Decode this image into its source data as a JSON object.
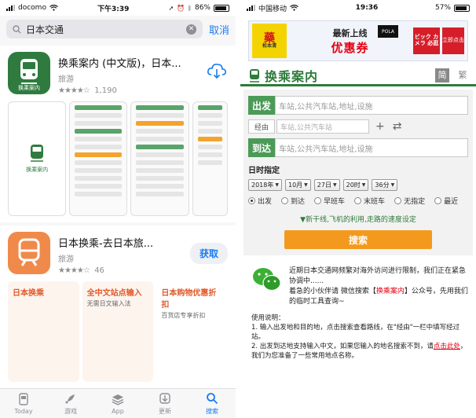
{
  "left": {
    "status": {
      "carrier": "docomo",
      "time": "下午3:39",
      "battery": "86%"
    },
    "search": {
      "query": "日本交通",
      "cancel": "取消"
    },
    "app1": {
      "title": "换乘案内 (中文版)，日本...",
      "category": "旅游",
      "rating_count": "1,190",
      "icon_label": "换乘案内"
    },
    "app2": {
      "title": "日本换乘-去日本旅...",
      "category": "旅游",
      "rating_count": "46",
      "get": "获取",
      "shot1": "日本换乘",
      "shot2_title": "全中文站点输入",
      "shot2_sub": "无需日文输入法",
      "shot3_title": "日本购物优惠折扣",
      "shot3_sub": "百货店专享折扣"
    },
    "tabs": [
      {
        "label": "Today",
        "icon": "today-icon"
      },
      {
        "label": "游戏",
        "icon": "rocket-icon"
      },
      {
        "label": "App",
        "icon": "layers-icon"
      },
      {
        "label": "更新",
        "icon": "download-icon"
      },
      {
        "label": "搜索",
        "icon": "search-icon"
      }
    ]
  },
  "right": {
    "status": {
      "carrier": "中国移动",
      "time": "19:36",
      "battery": "57%"
    },
    "ad": {
      "store": "藥",
      "store_sub": "松本清",
      "line1": "最新上线",
      "line2": "优惠券",
      "pola": "POLA",
      "bic": "ビック カメラ 必逛",
      "go": "立即点击"
    },
    "brand": {
      "name": "换乘案内",
      "lang_simplified": "简",
      "lang_traditional": "繁"
    },
    "form": {
      "from_label": "出发",
      "from_placeholder": "车站,公共汽车站,地址,设施",
      "via_label": "经由",
      "via_placeholder": "车站,公共汽车站",
      "to_label": "到达",
      "to_placeholder": "车站,公共汽车站,地址,设施",
      "date_title": "日时指定",
      "year": "2018年",
      "month": "10月",
      "day": "27日",
      "hour": "20时",
      "minute": "36分",
      "opt_depart": "出发",
      "opt_arrive": "到达",
      "opt_first": "早班车",
      "opt_last": "末班车",
      "opt_none": "无指定",
      "opt_latest": "最近",
      "more_link": "▼新干线,飞机的利用,走路的速度设定",
      "search_btn": "搜索"
    },
    "notice": {
      "line1": "近期日本交通网频繁对海外访问进行限制，我们正在紧急协调中......",
      "line2a": "着急的小伙伴请 微信搜索【",
      "line2b": "换乘案内",
      "line2c": "】公众号，先用我们的临时工具查询~"
    },
    "usage": {
      "title": "使用说明：",
      "item1": "1. 输入出发地和目的地，点击搜索查看路线，在\"经由\"一栏中填写经过站。",
      "item2a": "2. 出发到达地支持输入中文，如果您输入的地名搜索不到，请",
      "item2b": "点击此处",
      "item2c": "，我们为您准备了一些常用地点名称。"
    }
  }
}
